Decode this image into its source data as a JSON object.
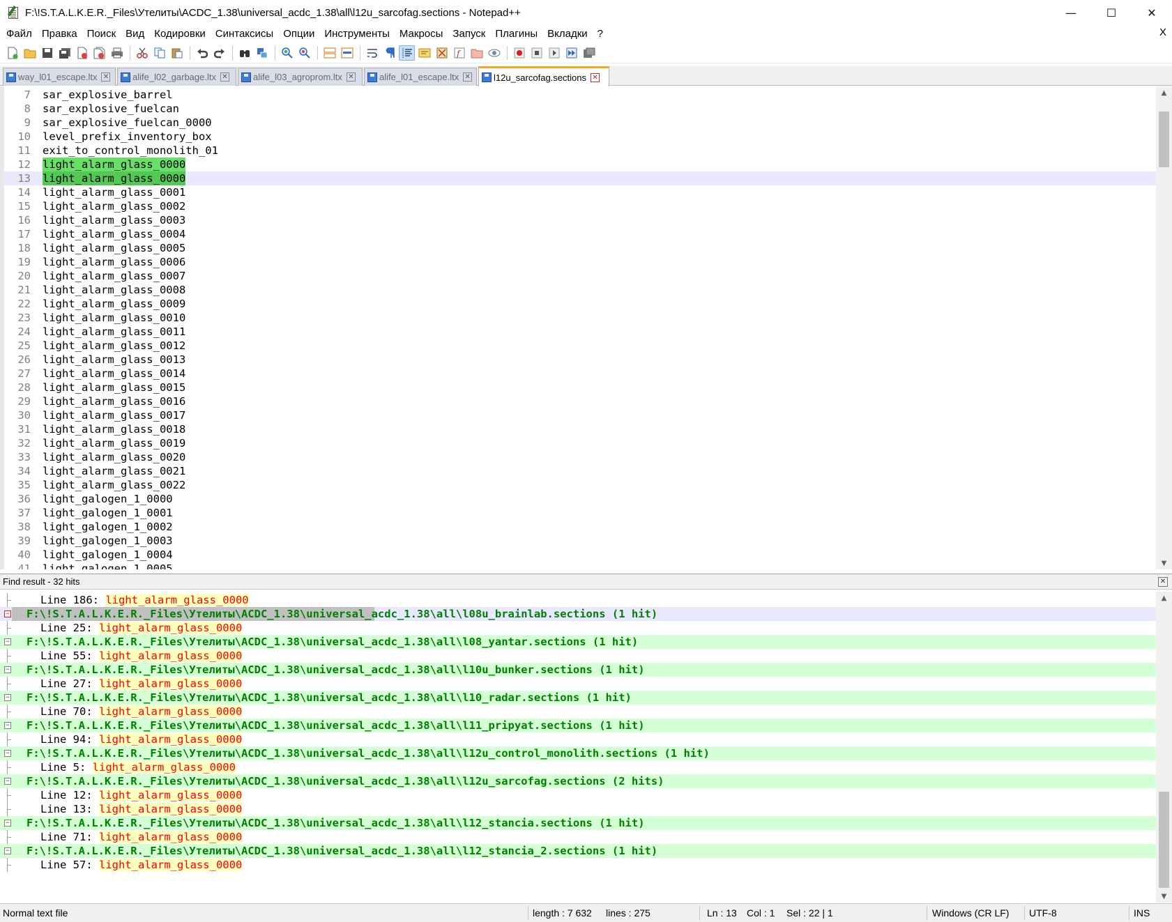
{
  "window": {
    "title": "F:\\!S.T.A.L.K.E.R._Files\\Утелиты\\ACDC_1.38\\universal_acdc_1.38\\all\\l12u_sarcofag.sections - Notepad++",
    "minimize_glyph": "—",
    "maximize_glyph": "☐",
    "close_glyph": "✕"
  },
  "menu": {
    "items": [
      "Файл",
      "Правка",
      "Поиск",
      "Вид",
      "Кодировки",
      "Синтаксисы",
      "Опции",
      "Инструменты",
      "Макросы",
      "Запуск",
      "Плагины",
      "Вкладки",
      "?"
    ],
    "close_label": "X"
  },
  "toolbar": {
    "icons": [
      "new-file-icon",
      "open-file-icon",
      "save-icon",
      "save-all-icon",
      "close-icon",
      "close-all-icon",
      "print-icon",
      "cut-icon",
      "copy-icon",
      "paste-icon",
      "undo-icon",
      "redo-icon",
      "find-icon",
      "replace-icon",
      "zoom-in-icon",
      "zoom-out-icon",
      "sync-vertical-icon",
      "sync-horizontal-icon",
      "word-wrap-icon",
      "show-all-chars-icon",
      "indent-guide-icon",
      "user-language-icon",
      "document-map-icon",
      "function-list-icon",
      "folder-workspace-icon",
      "monitoring-icon",
      "record-macro-icon",
      "stop-record-icon",
      "play-macro-icon",
      "run-macro-multiple-icon",
      "save-macro-icon"
    ]
  },
  "tabs": [
    {
      "label": "way_l01_escape.ltx",
      "active": false
    },
    {
      "label": "alife_l02_garbage.ltx",
      "active": false
    },
    {
      "label": "alife_l03_agroprom.ltx",
      "active": false
    },
    {
      "label": "alife_l01_escape.ltx",
      "active": false
    },
    {
      "label": "l12u_sarcofag.sections",
      "active": true
    }
  ],
  "editor": {
    "lines": [
      {
        "n": "7",
        "text": "sar_explosive_barrel"
      },
      {
        "n": "8",
        "text": "sar_explosive_fuelcan"
      },
      {
        "n": "9",
        "text": "sar_explosive_fuelcan_0000"
      },
      {
        "n": "10",
        "text": "level_prefix_inventory_box"
      },
      {
        "n": "11",
        "text": "exit_to_control_monolith_01"
      },
      {
        "n": "12",
        "text": "light_alarm_glass_0000",
        "hl": true
      },
      {
        "n": "13",
        "text": "light_alarm_glass_0000",
        "hl": true,
        "current": true
      },
      {
        "n": "14",
        "text": "light_alarm_glass_0001"
      },
      {
        "n": "15",
        "text": "light_alarm_glass_0002"
      },
      {
        "n": "16",
        "text": "light_alarm_glass_0003"
      },
      {
        "n": "17",
        "text": "light_alarm_glass_0004"
      },
      {
        "n": "18",
        "text": "light_alarm_glass_0005"
      },
      {
        "n": "19",
        "text": "light_alarm_glass_0006"
      },
      {
        "n": "20",
        "text": "light_alarm_glass_0007"
      },
      {
        "n": "21",
        "text": "light_alarm_glass_0008"
      },
      {
        "n": "22",
        "text": "light_alarm_glass_0009"
      },
      {
        "n": "23",
        "text": "light_alarm_glass_0010"
      },
      {
        "n": "24",
        "text": "light_alarm_glass_0011"
      },
      {
        "n": "25",
        "text": "light_alarm_glass_0012"
      },
      {
        "n": "26",
        "text": "light_alarm_glass_0013"
      },
      {
        "n": "27",
        "text": "light_alarm_glass_0014"
      },
      {
        "n": "28",
        "text": "light_alarm_glass_0015"
      },
      {
        "n": "29",
        "text": "light_alarm_glass_0016"
      },
      {
        "n": "30",
        "text": "light_alarm_glass_0017"
      },
      {
        "n": "31",
        "text": "light_alarm_glass_0018"
      },
      {
        "n": "32",
        "text": "light_alarm_glass_0019"
      },
      {
        "n": "33",
        "text": "light_alarm_glass_0020"
      },
      {
        "n": "34",
        "text": "light_alarm_glass_0021"
      },
      {
        "n": "35",
        "text": "light_alarm_glass_0022"
      },
      {
        "n": "36",
        "text": "light_galogen_1_0000"
      },
      {
        "n": "37",
        "text": "light_galogen_1_0001"
      },
      {
        "n": "38",
        "text": "light_galogen_1_0002"
      },
      {
        "n": "39",
        "text": "light_galogen_1_0003"
      },
      {
        "n": "40",
        "text": "light_galogen_1_0004"
      },
      {
        "n": "41",
        "text": "light_galogen_1_0005"
      }
    ]
  },
  "find_results": {
    "header": "Find result - 32 hits",
    "close_glyph": "✕",
    "rows": [
      {
        "kind": "hit",
        "prefix": "Line 186: ",
        "match": "light_alarm_glass_0000"
      },
      {
        "kind": "file",
        "text": "F:\\!S.T.A.L.K.E.R._Files\\Утелиты\\ACDC_1.38\\universal_acdc_1.38\\all\\l08u_brainlab.sections (1 hit)",
        "current": true
      },
      {
        "kind": "hit",
        "prefix": "Line 25: ",
        "match": "light_alarm_glass_0000"
      },
      {
        "kind": "file",
        "text": "F:\\!S.T.A.L.K.E.R._Files\\Утелиты\\ACDC_1.38\\universal_acdc_1.38\\all\\l08_yantar.sections (1 hit)"
      },
      {
        "kind": "hit",
        "prefix": "Line 55: ",
        "match": "light_alarm_glass_0000"
      },
      {
        "kind": "file",
        "text": "F:\\!S.T.A.L.K.E.R._Files\\Утелиты\\ACDC_1.38\\universal_acdc_1.38\\all\\l10u_bunker.sections (1 hit)"
      },
      {
        "kind": "hit",
        "prefix": "Line 27: ",
        "match": "light_alarm_glass_0000"
      },
      {
        "kind": "file",
        "text": "F:\\!S.T.A.L.K.E.R._Files\\Утелиты\\ACDC_1.38\\universal_acdc_1.38\\all\\l10_radar.sections (1 hit)"
      },
      {
        "kind": "hit",
        "prefix": "Line 70: ",
        "match": "light_alarm_glass_0000"
      },
      {
        "kind": "file",
        "text": "F:\\!S.T.A.L.K.E.R._Files\\Утелиты\\ACDC_1.38\\universal_acdc_1.38\\all\\l11_pripyat.sections (1 hit)"
      },
      {
        "kind": "hit",
        "prefix": "Line 94: ",
        "match": "light_alarm_glass_0000"
      },
      {
        "kind": "file",
        "text": "F:\\!S.T.A.L.K.E.R._Files\\Утелиты\\ACDC_1.38\\universal_acdc_1.38\\all\\l12u_control_monolith.sections (1 hit)"
      },
      {
        "kind": "hit",
        "prefix": "Line 5: ",
        "match": "light_alarm_glass_0000"
      },
      {
        "kind": "file",
        "text": "F:\\!S.T.A.L.K.E.R._Files\\Утелиты\\ACDC_1.38\\universal_acdc_1.38\\all\\l12u_sarcofag.sections (2 hits)"
      },
      {
        "kind": "hit",
        "prefix": "Line 12: ",
        "match": "light_alarm_glass_0000"
      },
      {
        "kind": "hit",
        "prefix": "Line 13: ",
        "match": "light_alarm_glass_0000"
      },
      {
        "kind": "file",
        "text": "F:\\!S.T.A.L.K.E.R._Files\\Утелиты\\ACDC_1.38\\universal_acdc_1.38\\all\\l12_stancia.sections (1 hit)"
      },
      {
        "kind": "hit",
        "prefix": "Line 71: ",
        "match": "light_alarm_glass_0000"
      },
      {
        "kind": "file",
        "text": "F:\\!S.T.A.L.K.E.R._Files\\Утелиты\\ACDC_1.38\\universal_acdc_1.38\\all\\l12_stancia_2.sections (1 hit)"
      },
      {
        "kind": "hit",
        "prefix": "Line 57: ",
        "match": "light_alarm_glass_0000"
      }
    ]
  },
  "statusbar": {
    "file_type": "Normal text file",
    "length": "length : 7 632",
    "lines": "lines : 275",
    "ln": "Ln : 13",
    "col": "Col : 1",
    "sel": "Sel : 22 | 1",
    "eol": "Windows (CR LF)",
    "encoding": "UTF-8",
    "mode": "INS"
  },
  "colors": {
    "tab_accent": "#f5a623",
    "match_highlight": "#68e068",
    "file_row_bg": "#d5ffd5",
    "file_row_text": "#008000",
    "hit_text": "#ff0000",
    "hit_bg": "#ffffbf",
    "current_line": "#e8e8ff"
  }
}
